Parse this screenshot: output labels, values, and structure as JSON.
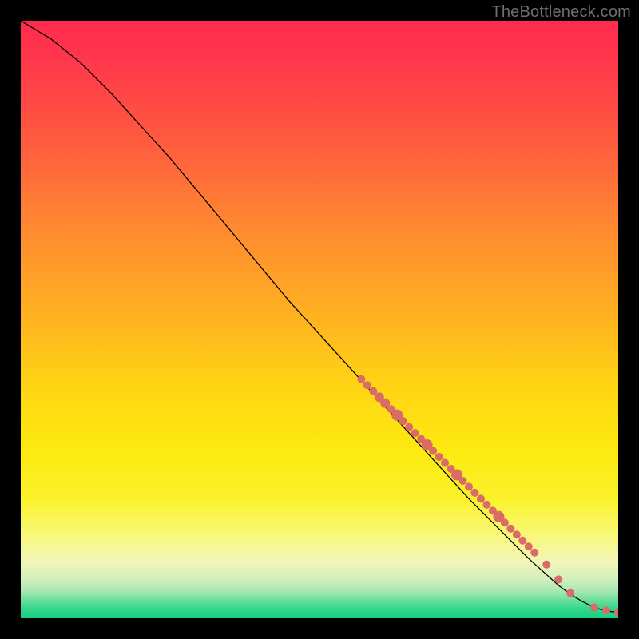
{
  "watermark": "TheBottleneck.com",
  "colors": {
    "dot_fill": "#db6b66",
    "curve": "#000000",
    "gradient_stops": [
      {
        "offset": 0.0,
        "color": "#ff2b4e"
      },
      {
        "offset": 0.08,
        "color": "#ff3a4a"
      },
      {
        "offset": 0.2,
        "color": "#ff5a3f"
      },
      {
        "offset": 0.35,
        "color": "#ff8a30"
      },
      {
        "offset": 0.5,
        "color": "#ffb31f"
      },
      {
        "offset": 0.62,
        "color": "#ffd613"
      },
      {
        "offset": 0.72,
        "color": "#fcea10"
      },
      {
        "offset": 0.8,
        "color": "#fbf22b"
      },
      {
        "offset": 0.86,
        "color": "#f8f879"
      },
      {
        "offset": 0.905,
        "color": "#f2f6b8"
      },
      {
        "offset": 0.935,
        "color": "#d2efbd"
      },
      {
        "offset": 0.955,
        "color": "#a6e8b1"
      },
      {
        "offset": 0.972,
        "color": "#63dd9b"
      },
      {
        "offset": 0.985,
        "color": "#2fd68e"
      },
      {
        "offset": 1.0,
        "color": "#17cf82"
      }
    ]
  },
  "chart_data": {
    "type": "line",
    "title": "",
    "xlabel": "",
    "ylabel": "",
    "xlim": [
      0,
      100
    ],
    "ylim": [
      0,
      100
    ],
    "series": [
      {
        "name": "curve",
        "x": [
          0,
          5,
          10,
          15,
          20,
          25,
          30,
          35,
          40,
          45,
          50,
          55,
          60,
          65,
          70,
          75,
          80,
          85,
          90,
          92,
          94,
          96,
          98,
          100
        ],
        "y": [
          100,
          97,
          93,
          88,
          82.5,
          77,
          71,
          65,
          59,
          53,
          47.5,
          42,
          36.5,
          31,
          25.5,
          20,
          15,
          10,
          5.5,
          4,
          2.8,
          1.8,
          1.2,
          1.0
        ]
      }
    ],
    "highlight_points": {
      "name": "dots",
      "x": [
        57,
        58,
        59,
        60,
        61,
        62,
        63,
        64,
        65,
        66,
        67,
        68,
        69,
        70,
        71,
        72,
        73,
        74,
        75,
        76,
        77,
        78,
        79,
        80,
        81,
        82,
        83,
        84,
        85,
        86,
        88,
        90,
        92,
        96,
        98,
        100
      ],
      "y": [
        40,
        39,
        38,
        37,
        36,
        35,
        34,
        33,
        32,
        31,
        30,
        29,
        28,
        27,
        26,
        25,
        24,
        23,
        22,
        21,
        20,
        19,
        18,
        17,
        16,
        15,
        14,
        13,
        12,
        11,
        9,
        6.5,
        4.2,
        1.8,
        1.3,
        1.0
      ],
      "r": [
        5,
        5,
        5,
        6,
        6,
        5,
        7,
        5,
        5,
        5,
        5,
        7,
        5,
        5,
        5,
        5,
        7,
        5,
        5,
        5,
        5,
        5,
        5,
        7,
        5,
        5,
        5,
        5,
        5,
        5,
        5,
        5,
        5,
        5,
        5,
        5
      ]
    }
  }
}
